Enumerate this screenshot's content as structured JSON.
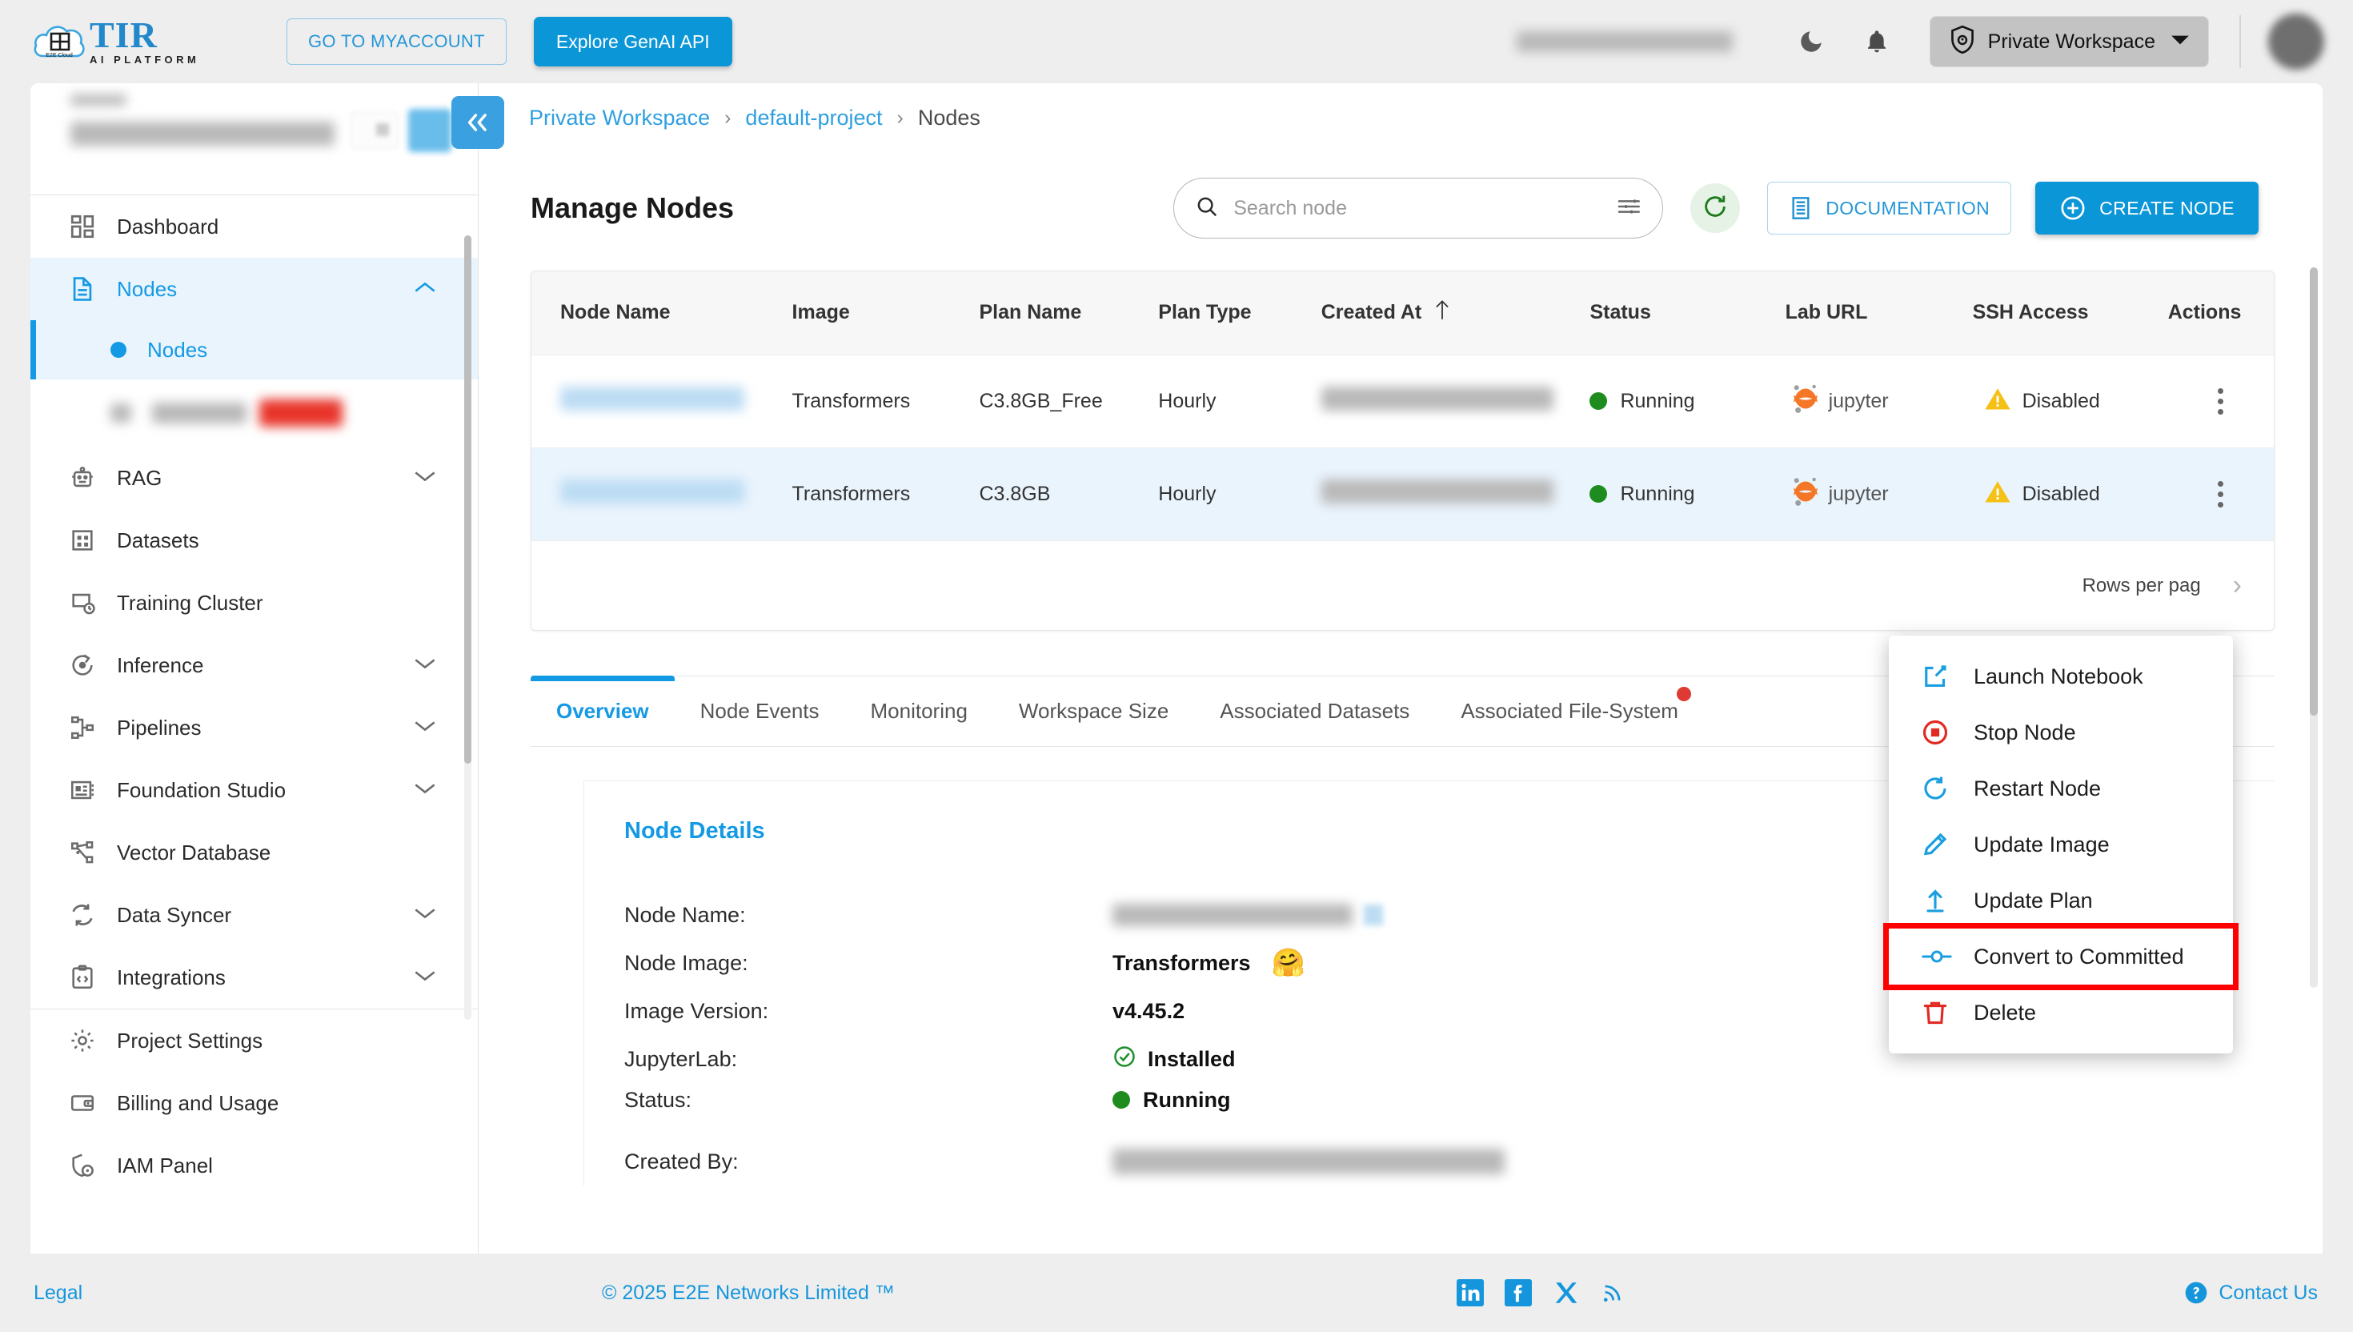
{
  "topbar": {
    "logo_title": "TIR",
    "logo_subtitle": "AI PLATFORM",
    "logo_badge": "E2E Cloud",
    "myaccount_label": "GO TO MYACCOUNT",
    "genai_label": "Explore GenAI API",
    "workspace_label": "Private Workspace",
    "theme_icon": "moon-icon",
    "bell_icon": "notification-bell-icon",
    "avatar_icon": "user-avatar"
  },
  "sidebar": {
    "items": [
      {
        "label": "Dashboard",
        "icon": "dashboard-icon",
        "expandable": false,
        "state": ""
      },
      {
        "label": "Nodes",
        "icon": "document-icon",
        "expandable": true,
        "state": "active",
        "chevron": "chevron-up-icon"
      },
      {
        "label": "RAG",
        "icon": "robot-icon",
        "expandable": true,
        "state": "",
        "chevron": "chevron-down-icon"
      },
      {
        "label": "Datasets",
        "icon": "grid-icon",
        "expandable": false,
        "state": ""
      },
      {
        "label": "Training Cluster",
        "icon": "cluster-clock-icon",
        "expandable": false,
        "state": ""
      },
      {
        "label": "Inference",
        "icon": "inference-icon",
        "expandable": true,
        "state": "",
        "chevron": "chevron-down-icon"
      },
      {
        "label": "Pipelines",
        "icon": "pipeline-icon",
        "expandable": true,
        "state": "",
        "chevron": "chevron-down-icon"
      },
      {
        "label": "Foundation Studio",
        "icon": "foundation-icon",
        "expandable": true,
        "state": "",
        "chevron": "chevron-down-icon"
      },
      {
        "label": "Vector Database",
        "icon": "vector-db-icon",
        "expandable": false,
        "state": ""
      },
      {
        "label": "Data Syncer",
        "icon": "sync-icon",
        "expandable": true,
        "state": "",
        "chevron": "chevron-down-icon"
      },
      {
        "label": "Integrations",
        "icon": "integrations-icon",
        "expandable": true,
        "state": "",
        "chevron": "chevron-down-icon"
      },
      {
        "label": "Project Settings",
        "icon": "gear-icon",
        "expandable": false,
        "state": ""
      },
      {
        "label": "Billing and Usage",
        "icon": "wallet-icon",
        "expandable": false,
        "state": ""
      },
      {
        "label": "IAM Panel",
        "icon": "iam-shield-icon",
        "expandable": false,
        "state": ""
      }
    ],
    "sub_item": {
      "label": "Nodes",
      "icon": "bullet-dot-icon"
    }
  },
  "breadcrumb": {
    "collapse_icon": "double-chevron-left-icon",
    "workspace": "Private Workspace",
    "project": "default-project",
    "current": "Nodes",
    "separator": "›"
  },
  "page": {
    "title": "Manage Nodes",
    "search_placeholder": "Search node",
    "search_value": "",
    "search_icon": "search-icon",
    "filter_icon": "tune-filter-icon",
    "refresh_icon": "refresh-icon",
    "documentation_label": "DOCUMENTATION",
    "documentation_icon": "book-icon",
    "create_label": "CREATE NODE",
    "create_icon": "plus-circle-icon"
  },
  "table": {
    "columns": [
      "Node Name",
      "Image",
      "Plan Name",
      "Plan Type",
      "Created At",
      "Status",
      "Lab URL",
      "SSH Access",
      "Actions"
    ],
    "sorted_column": "Created At",
    "sort_direction": "asc",
    "rows": [
      {
        "node_name": "",
        "image": "Transformers",
        "plan_name": "C3.8GB_Free",
        "plan_type": "Hourly",
        "created_at": "",
        "status": "Running",
        "lab_url": "jupyter",
        "ssh_access": "Disabled",
        "actions_icon": "kebab-menu-icon",
        "selected": false
      },
      {
        "node_name": "",
        "image": "Transformers",
        "plan_name": "C3.8GB",
        "plan_type": "Hourly",
        "created_at": "",
        "status": "Running",
        "lab_url": "jupyter",
        "ssh_access": "Disabled",
        "actions_icon": "kebab-menu-icon",
        "selected": true
      }
    ],
    "pager": {
      "rows_per_page_label": "Rows per pag",
      "next_icon": "chevron-right-icon"
    }
  },
  "context_menu": {
    "items": [
      {
        "label": "Launch Notebook",
        "icon": "external-link-icon",
        "color": "#199fe0",
        "highlighted": false
      },
      {
        "label": "Stop Node",
        "icon": "stop-circle-icon",
        "color": "#e02a22",
        "highlighted": false
      },
      {
        "label": "Restart Node",
        "icon": "restart-icon",
        "color": "#199fe0",
        "highlighted": false
      },
      {
        "label": "Update Image",
        "icon": "pencil-icon",
        "color": "#199fe0",
        "highlighted": false
      },
      {
        "label": "Update Plan",
        "icon": "upload-arrow-icon",
        "color": "#199fe0",
        "highlighted": false
      },
      {
        "label": "Convert to Committed",
        "icon": "node-convert-icon",
        "color": "#199fe0",
        "highlighted": true
      },
      {
        "label": "Delete",
        "icon": "trash-icon",
        "color": "#e02a22",
        "highlighted": false
      }
    ],
    "highlight_color": "#ff0000"
  },
  "tabs": {
    "items": [
      {
        "label": "Overview",
        "active": true,
        "badge": false
      },
      {
        "label": "Node Events",
        "active": false,
        "badge": false
      },
      {
        "label": "Monitoring",
        "active": false,
        "badge": false
      },
      {
        "label": "Workspace Size",
        "active": false,
        "badge": false
      },
      {
        "label": "Associated Datasets",
        "active": false,
        "badge": false
      },
      {
        "label": "Associated File-System",
        "active": false,
        "badge": true
      }
    ]
  },
  "details": {
    "heading": "Node Details",
    "fields": [
      {
        "label": "Node Name:",
        "value": "",
        "type": "blurred"
      },
      {
        "label": "Node Image:",
        "value": "Transformers",
        "type": "emoji",
        "emoji": "🤗"
      },
      {
        "label": "Image Version:",
        "value": "v4.45.2",
        "type": "text"
      },
      {
        "label": "JupyterLab:",
        "value": "Installed",
        "type": "check"
      },
      {
        "label": "Status:",
        "value": "Running",
        "type": "status"
      },
      {
        "label": "Created By:",
        "value": "",
        "type": "blurred"
      }
    ]
  },
  "footer": {
    "legal": "Legal",
    "copyright": "© 2025 E2E Networks Limited ™",
    "contact": "Contact Us",
    "contact_icon": "help-circle-icon",
    "social": [
      {
        "name": "linkedin-icon",
        "glyph": "in"
      },
      {
        "name": "facebook-icon",
        "glyph": "f"
      },
      {
        "name": "x-twitter-icon",
        "glyph": "X"
      },
      {
        "name": "rss-icon",
        "glyph": "rss"
      }
    ]
  },
  "colors": {
    "accent": "#0b96d8",
    "link": "#1596dc",
    "success": "#1e8c1e",
    "warning": "#f5c116",
    "danger": "#e02a22",
    "highlight": "#ff0000"
  }
}
